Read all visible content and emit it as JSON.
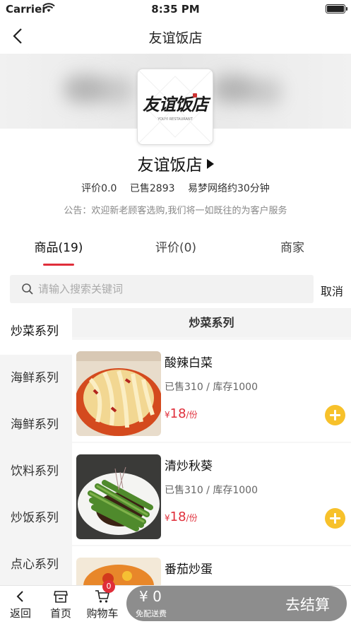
{
  "status_bar": {
    "carrier": "Carrier",
    "time": "8:35 PM"
  },
  "nav": {
    "title": "友谊饭店"
  },
  "shop": {
    "name": "友谊饭店",
    "logo_text": "友谊饭店",
    "rating": "评价0.0",
    "sold": "已售2893",
    "delivery": "易梦网络约30分钟",
    "notice": "公告：欢迎新老顾客选购,我们将一如既往的为客户服务"
  },
  "tabs": [
    {
      "label": "商品(19)",
      "active": true
    },
    {
      "label": "评价(0)",
      "active": false
    },
    {
      "label": "商家",
      "active": false
    }
  ],
  "search": {
    "placeholder": "请输入搜索关键词",
    "value": "",
    "cancel_label": "取消"
  },
  "categories": [
    {
      "label": "炒菜系列",
      "active": true
    },
    {
      "label": "海鲜系列",
      "active": false
    },
    {
      "label": "海鲜系列",
      "active": false
    },
    {
      "label": "饮料系列",
      "active": false
    },
    {
      "label": "炒饭系列",
      "active": false
    },
    {
      "label": "点心系列",
      "active": false
    }
  ],
  "current_category": "炒菜系列",
  "products": [
    {
      "name": "酸辣白菜",
      "sold": "已售310",
      "stock": "库存1000",
      "currency": "¥",
      "price": "18",
      "unit": "/份"
    },
    {
      "name": "清炒秋葵",
      "sold": "已售310",
      "stock": "库存1000",
      "currency": "¥",
      "price": "18",
      "unit": "/份"
    },
    {
      "name": "番茄炒蛋",
      "sold": "",
      "stock": "",
      "currency": "",
      "price": "",
      "unit": ""
    }
  ],
  "bottom_bar": {
    "back_label": "返回",
    "home_label": "首页",
    "cart_label": "购物车",
    "cart_count": "0",
    "total": "¥ 0",
    "delivery_note": "免配送费",
    "checkout_label": "去结算"
  },
  "colors": {
    "accent": "#e02e3a",
    "add_button": "#f7c12b",
    "cart_pill": "#8d8d8d"
  }
}
